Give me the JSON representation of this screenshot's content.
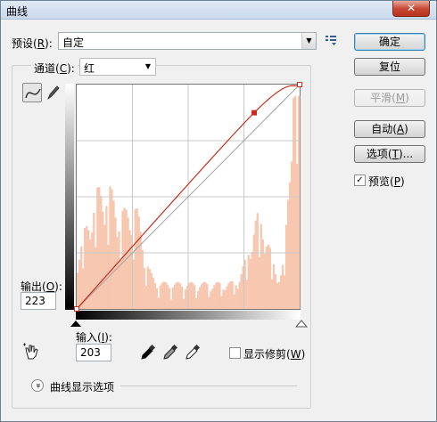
{
  "window": {
    "title": "曲线",
    "close_symbol": "✕"
  },
  "preset": {
    "label_pre": "预设(",
    "label_key": "R",
    "label_post": "):",
    "value": "自定"
  },
  "channel": {
    "label_pre": "通道(",
    "label_key": "C",
    "label_post": "):",
    "value": "红"
  },
  "buttons": {
    "ok": {
      "label": "确定"
    },
    "reset": {
      "label": "复位"
    },
    "smooth": {
      "pre": "平滑(",
      "key": "M",
      "post": ")"
    },
    "auto": {
      "pre": "自动(",
      "key": "A",
      "post": ")"
    },
    "options": {
      "pre": "选项(",
      "key": "T",
      "post": ")..."
    }
  },
  "preview": {
    "pre": "预览(",
    "key": "P",
    "post": ")",
    "checked": true,
    "check_glyph": "✓"
  },
  "output": {
    "pre": "输出(",
    "key": "O",
    "post": "):",
    "value": "223"
  },
  "input": {
    "pre": "输入(",
    "key": "I",
    "post": "):",
    "value": "203"
  },
  "show_clipping": {
    "pre": "显示修剪(",
    "key": "W",
    "post": ")",
    "checked": false
  },
  "display_options": {
    "label": "曲线显示选项",
    "expand_glyph": "»"
  },
  "colors": {
    "curve": "#cc2a1a",
    "histogram": "#f7c7b0",
    "grid": "#c8c8c8",
    "diagonal": "#a0a0a0"
  }
}
